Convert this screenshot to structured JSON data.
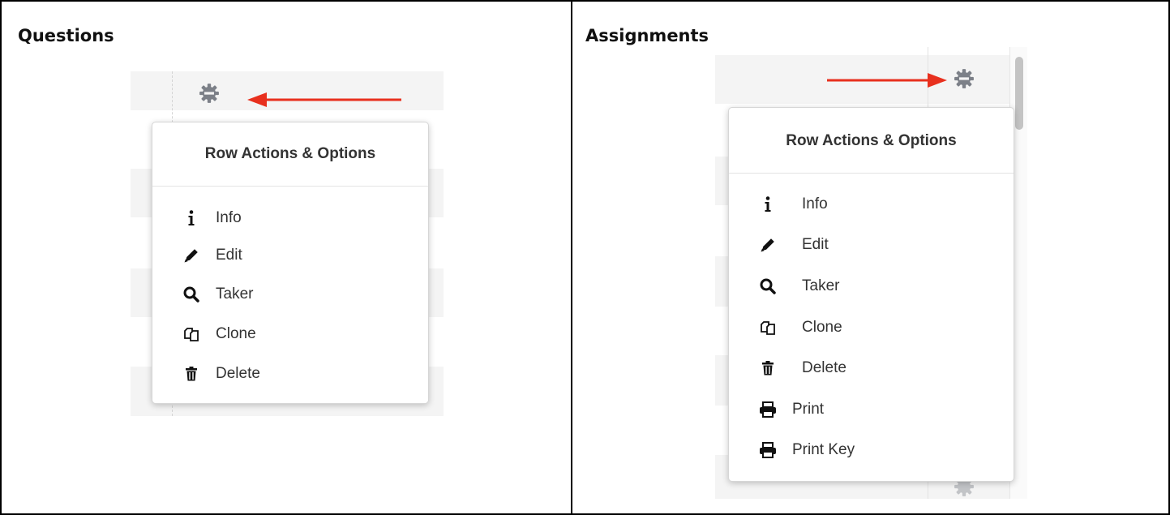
{
  "panels": {
    "questions": {
      "title": "Questions"
    },
    "assignments": {
      "title": "Assignments"
    }
  },
  "menu": {
    "title": "Row Actions & Options",
    "items": [
      {
        "label": "Info",
        "icon": "info-icon"
      },
      {
        "label": "Edit",
        "icon": "pencil-icon"
      },
      {
        "label": "Taker",
        "icon": "search-icon"
      },
      {
        "label": "Clone",
        "icon": "clone-icon"
      },
      {
        "label": "Delete",
        "icon": "trash-icon"
      },
      {
        "label": "Print",
        "icon": "print-icon"
      },
      {
        "label": "Print Key",
        "icon": "print-key-icon"
      }
    ]
  },
  "colors": {
    "gear": "#7c8088",
    "arrow": "#e8301e",
    "menu_text": "#333333",
    "row_band": "#f4f4f4"
  }
}
